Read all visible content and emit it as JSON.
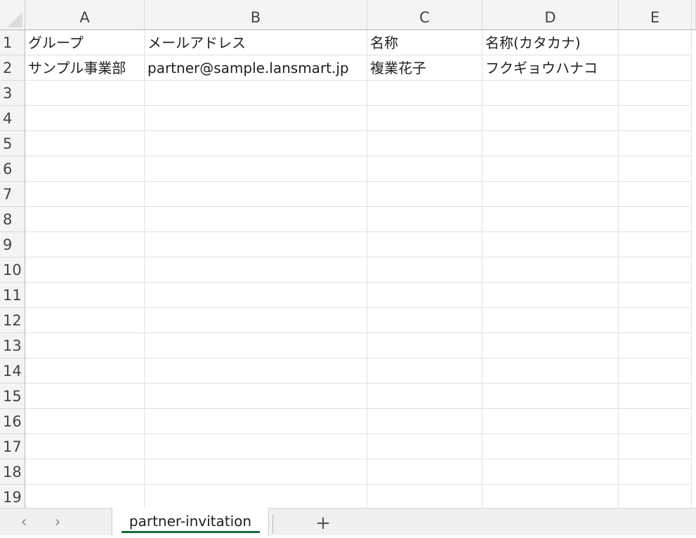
{
  "columns": [
    "A",
    "B",
    "C",
    "D",
    "E"
  ],
  "rows": [
    "1",
    "2",
    "3",
    "4",
    "5",
    "6",
    "7",
    "8",
    "9",
    "10",
    "11",
    "12",
    "13",
    "14",
    "15",
    "16",
    "17",
    "18",
    "19"
  ],
  "cells": {
    "row1": [
      "グループ",
      "メールアドレス",
      "名称",
      "名称(カタカナ)",
      ""
    ],
    "row2": [
      "サンプル事業部",
      "partner@sample.lansmart.jp",
      "複業花子",
      "フクギョウハナコ",
      ""
    ]
  },
  "sheet_tabs": {
    "prev_icon": "‹",
    "next_icon": "›",
    "active_tab": "partner-invitation",
    "add_icon": "+"
  },
  "colors": {
    "active_tab_underline": "#1d6b3b",
    "header_background": "#f4f4f4",
    "gridline": "#e1e1e1"
  }
}
